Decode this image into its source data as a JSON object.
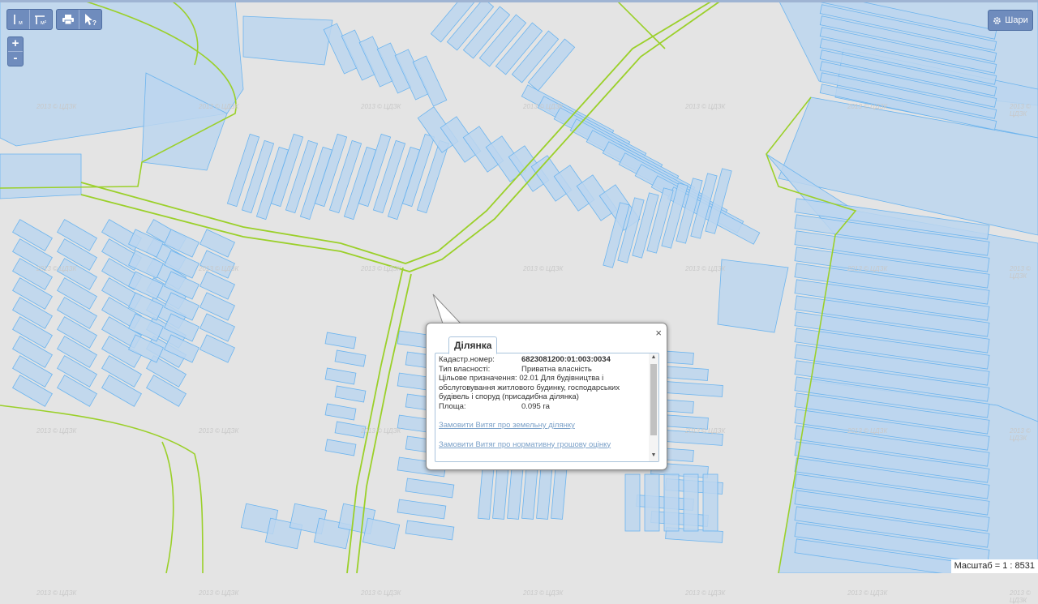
{
  "toolbar": {
    "measure_distance_sub": "м",
    "measure_area_sub": "м²",
    "print_icon": "printer-icon",
    "identify_icon": "pointer-question-icon"
  },
  "zoom": {
    "in_label": "+",
    "out_label": "-"
  },
  "layers": {
    "label": "Шари",
    "icon": "gear-icon"
  },
  "scale": {
    "text": "Масштаб = 1 : 8531"
  },
  "watermark": "2013 © ЦДЗК",
  "colors": {
    "map_bg": "#e4e4e4",
    "parcel_fill": "#bcd6ee",
    "parcel_stroke": "#6cb4ee",
    "boundary": "#9bd02a",
    "toolbar": "#6f8cbd"
  },
  "popup": {
    "close_label": "×",
    "tab_label": "Ділянка",
    "fields": {
      "cadastral_label": "Кадастр.номер:",
      "cadastral_value": "6823081200:01:003:0034",
      "ownership_label": "Тип власності:",
      "ownership_value": "Приватна власність",
      "purpose_label": "Цільове призначення:",
      "purpose_value": "02.01 Для будівництва і обслуговування житлового будинку, господарських будівель і споруд (присадибна ділянка)",
      "area_label": "Площа:",
      "area_value": "0.095 га"
    },
    "links": {
      "land_extract": "Замовити Витяг про земельну ділянку",
      "valuation_extract": "Замовити Витяг про нормативну грошову оцінку"
    }
  }
}
